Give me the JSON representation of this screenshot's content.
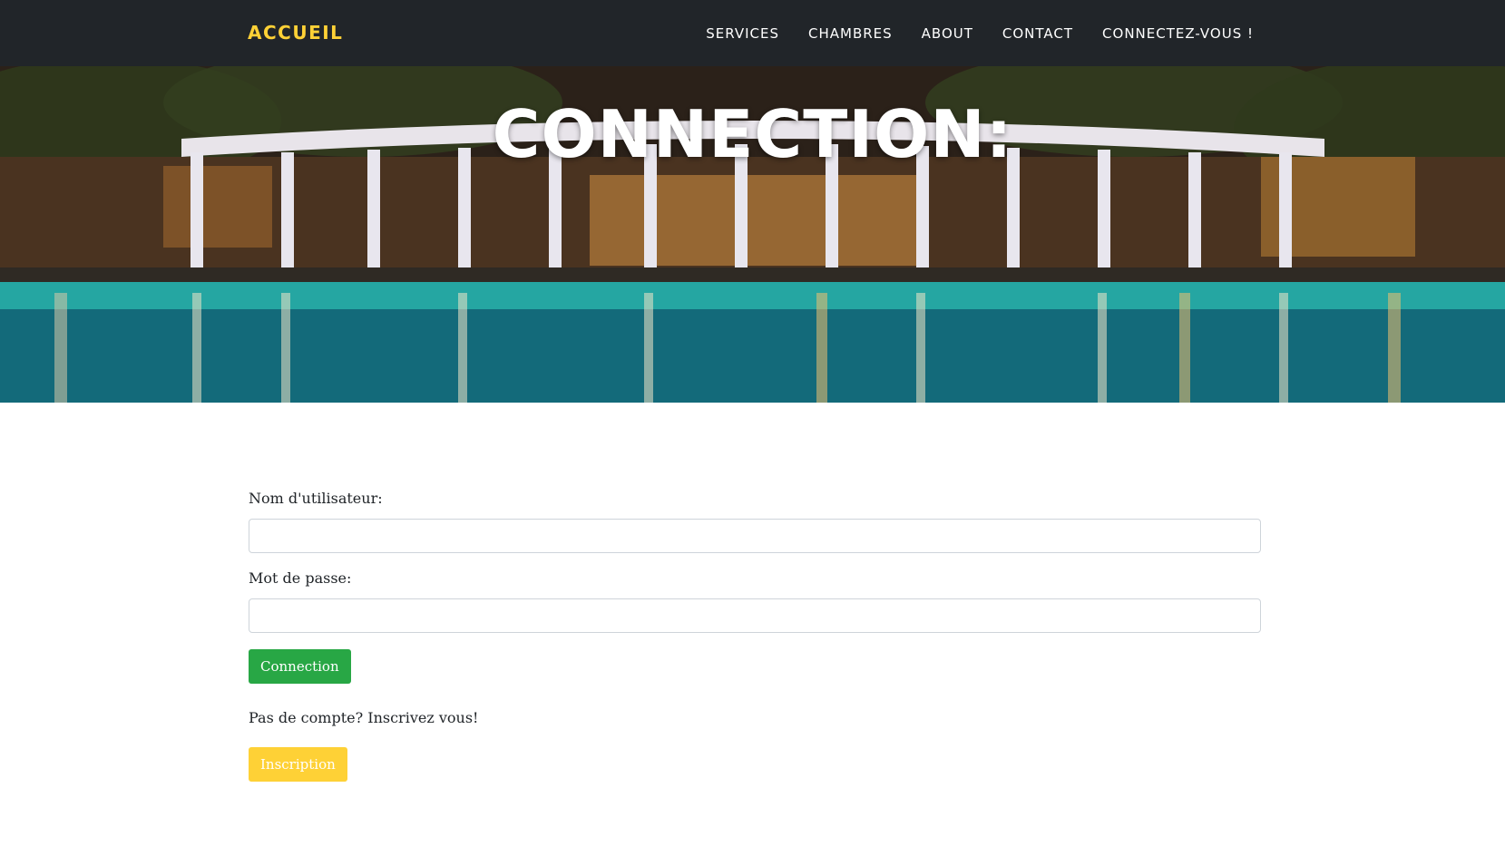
{
  "navbar": {
    "brand": "ACCUEIL",
    "links": [
      "SERVICES",
      "CHAMBRES",
      "ABOUT",
      "CONTACT",
      "CONNECTEZ-VOUS !"
    ]
  },
  "hero": {
    "title": "CONNECTION:"
  },
  "form": {
    "username_label": "Nom d'utilisateur:",
    "username_value": "",
    "password_label": "Mot de passe:",
    "password_value": "",
    "submit_label": "Connection",
    "signup_prompt": "Pas de compte? Inscrivez vous!",
    "signup_label": "Inscription"
  },
  "colors": {
    "navbar_bg": "#212529",
    "brand": "#fed136",
    "success": "#28a745",
    "warning": "#fed136"
  }
}
